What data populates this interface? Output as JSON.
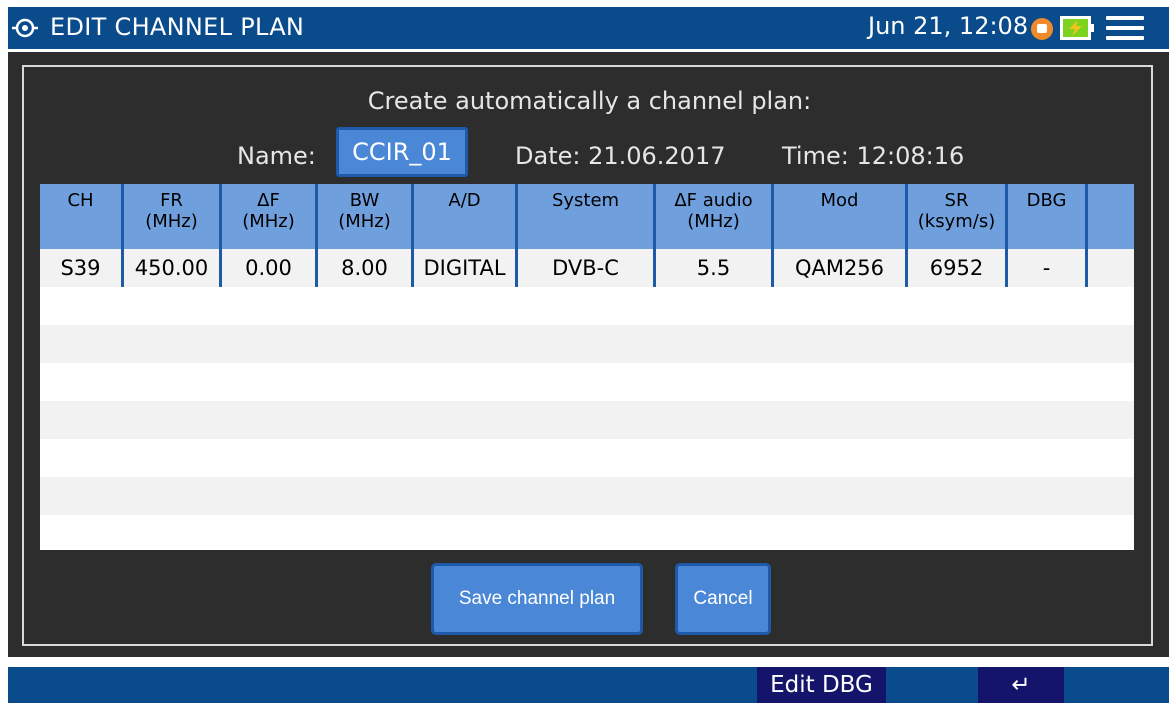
{
  "header": {
    "title": "EDIT CHANNEL PLAN",
    "datetime": "Jun 21, 12:08",
    "icons": [
      "target-icon",
      "record-icon",
      "battery-charging-icon",
      "menu-icon"
    ]
  },
  "form": {
    "heading": "Create automatically a channel plan:",
    "name_label": "Name:",
    "name_value": "CCIR_01",
    "date": "Date: 21.06.2017",
    "time": "Time: 12:08:16"
  },
  "table": {
    "columns": [
      {
        "line1": "CH",
        "line2": ""
      },
      {
        "line1": "FR",
        "line2": "(MHz)"
      },
      {
        "line1": "ΔF",
        "line2": "(MHz)"
      },
      {
        "line1": "BW",
        "line2": "(MHz)"
      },
      {
        "line1": "A/D",
        "line2": ""
      },
      {
        "line1": "System",
        "line2": ""
      },
      {
        "line1": "ΔF audio",
        "line2": "(MHz)"
      },
      {
        "line1": "Mod",
        "line2": ""
      },
      {
        "line1": "SR",
        "line2": "(ksym/s)"
      },
      {
        "line1": "DBG",
        "line2": ""
      },
      {
        "line1": "",
        "line2": ""
      }
    ],
    "rows": [
      [
        "S39",
        "450.00",
        "0.00",
        "8.00",
        "DIGITAL",
        "DVB-C",
        "5.5",
        "QAM256",
        "6952",
        "-",
        ""
      ]
    ]
  },
  "buttons": {
    "save": "Save channel plan",
    "cancel": "Cancel"
  },
  "footer": {
    "edit_dbg": "Edit DBG",
    "back": "↵"
  },
  "colors": {
    "topbar": "#0a4b8c",
    "panel": "#2d2d2d",
    "button": "#4a87d6",
    "header_cell": "#6fa0dd",
    "softkey": "#14146b",
    "rec": "#f08a2a",
    "battery_bolt": "#7ed321"
  }
}
